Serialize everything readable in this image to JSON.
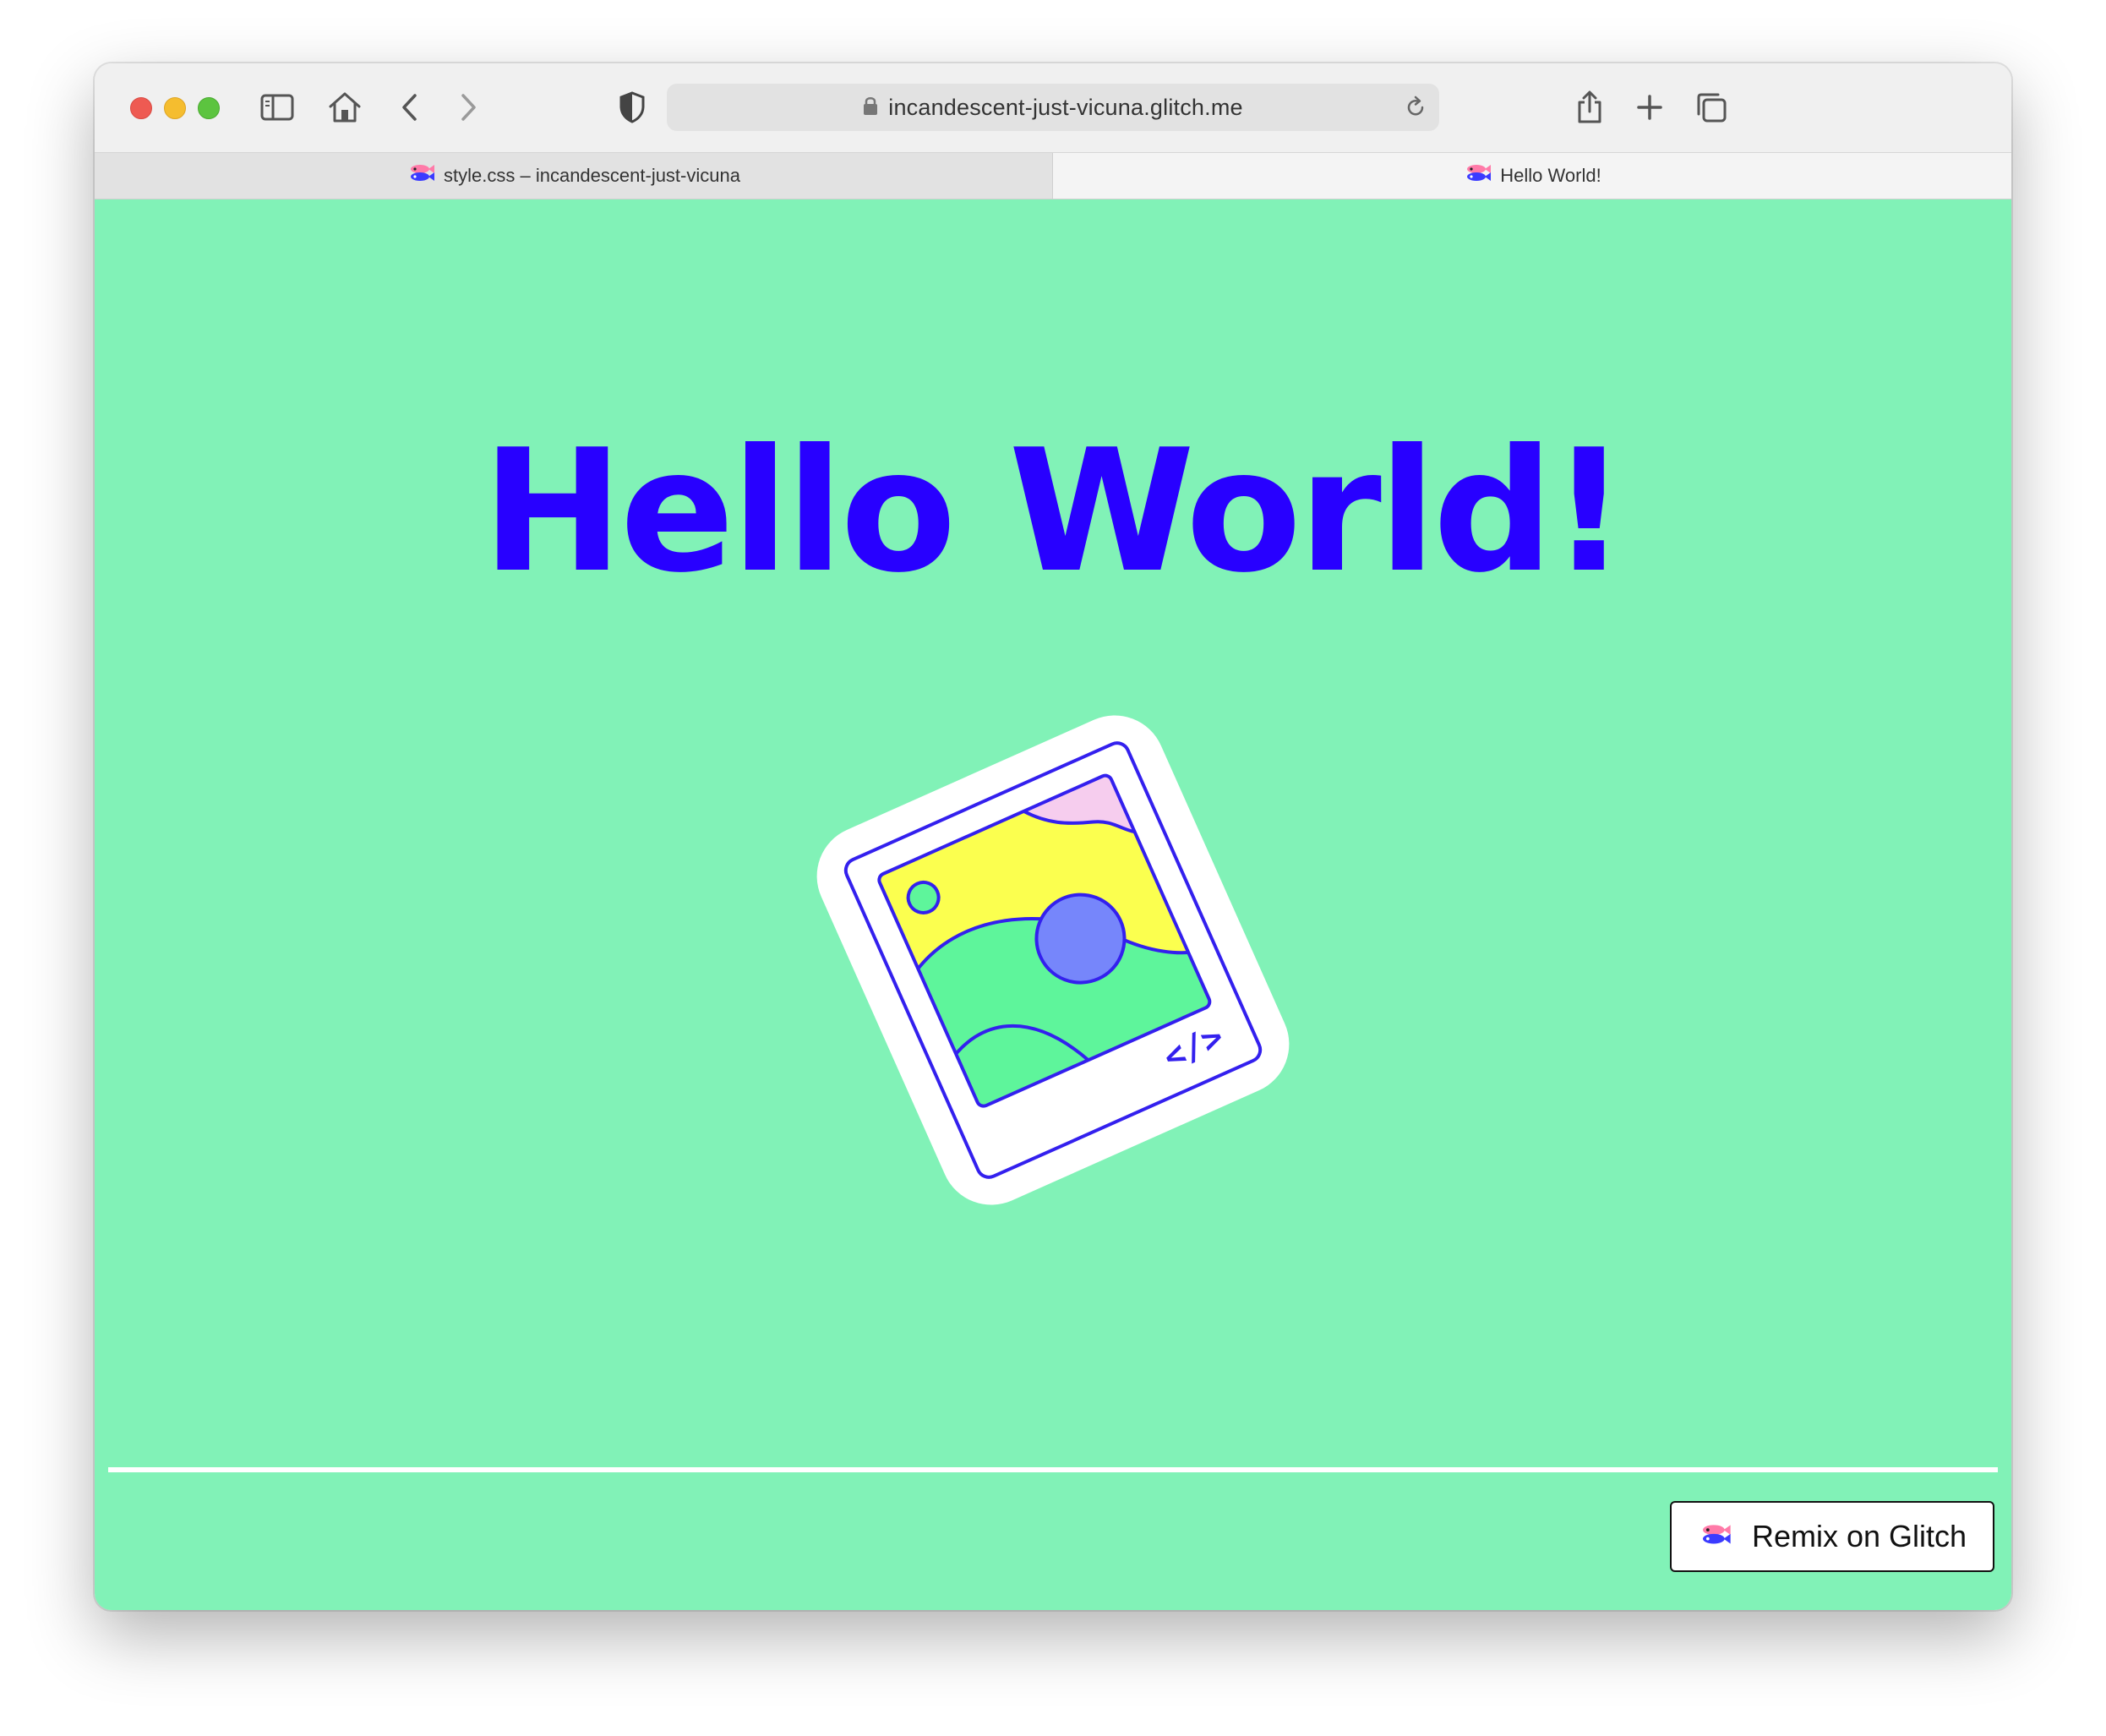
{
  "browser": {
    "url": "incandescent-just-vicuna.glitch.me",
    "tabs": [
      {
        "label": "style.css – incandescent-just-vicuna",
        "active": false
      },
      {
        "label": "Hello World!",
        "active": true
      }
    ],
    "icons": [
      "sidebar-icon",
      "home-icon",
      "back-icon",
      "forward-icon",
      "shield-icon",
      "lock-icon",
      "reload-icon",
      "share-icon",
      "new-tab-icon",
      "tab-overview-icon"
    ]
  },
  "page": {
    "heading": "Hello World!",
    "illustration_icon": "image-illustration",
    "remix_label": "Remix on Glitch"
  },
  "colors": {
    "background": "#81f2b7",
    "heading": "#2800ff",
    "divider": "#ffffff",
    "button_bg": "#ffffff"
  }
}
